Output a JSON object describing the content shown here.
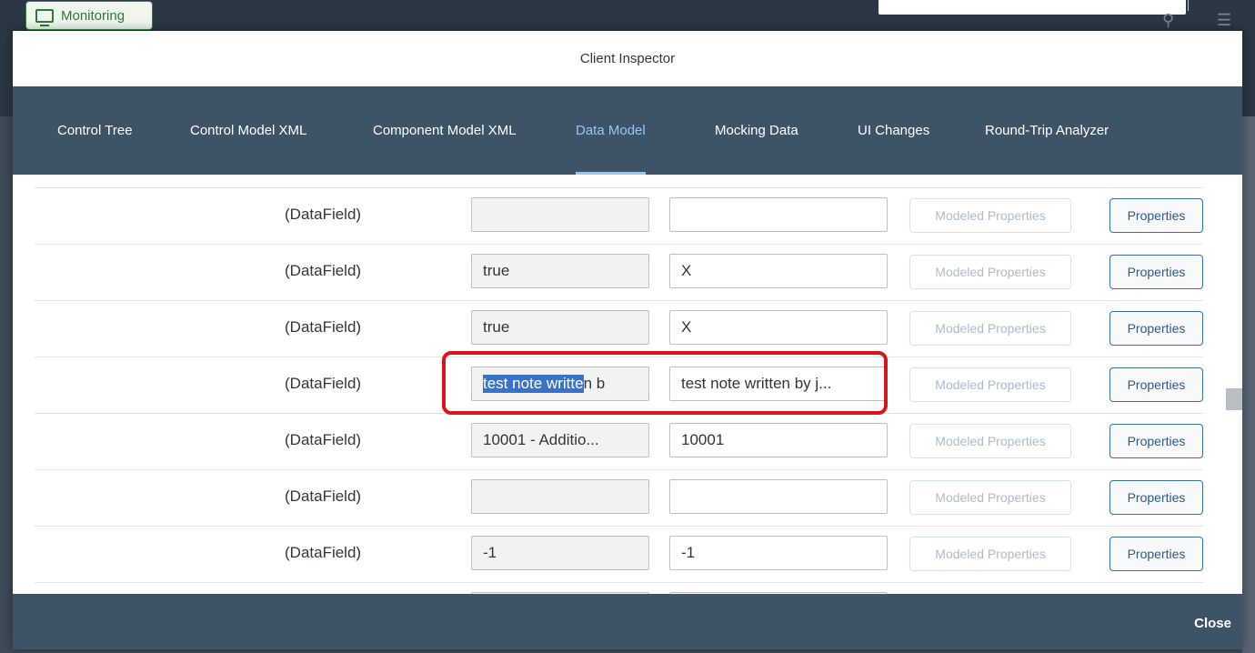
{
  "background": {
    "monitoring_label": "Monitoring"
  },
  "dialog": {
    "title": "Client Inspector",
    "close_label": "Close"
  },
  "tabs": [
    {
      "label": "Control Tree",
      "active": false
    },
    {
      "label": "Control Model XML",
      "active": false
    },
    {
      "label": "Component Model XML",
      "active": false
    },
    {
      "label": "Data Model",
      "active": true
    },
    {
      "label": "Mocking Data",
      "active": false
    },
    {
      "label": "UI Changes",
      "active": false
    },
    {
      "label": "Round-Trip Analyzer",
      "active": false
    }
  ],
  "rows": [
    {
      "label": "(DataField)",
      "value": "",
      "edit": "",
      "modeled_label": "Modeled Properties",
      "properties_label": "Properties"
    },
    {
      "label": "(DataField)",
      "value": "true",
      "edit": "X",
      "modeled_label": "Modeled Properties",
      "properties_label": "Properties"
    },
    {
      "label": "(DataField)",
      "value": "true",
      "edit": "X",
      "modeled_label": "Modeled Properties",
      "properties_label": "Properties"
    },
    {
      "label": "(DataField)",
      "value_selected": "test note writte",
      "value_rest": "n b",
      "edit": "test note written by j...",
      "modeled_label": "Modeled Properties",
      "properties_label": "Properties"
    },
    {
      "label": "(DataField)",
      "value": "10001 - Additio...",
      "edit": "10001",
      "modeled_label": "Modeled Properties",
      "properties_label": "Properties"
    },
    {
      "label": "(DataField)",
      "value": "",
      "edit": "",
      "modeled_label": "Modeled Properties",
      "properties_label": "Properties"
    },
    {
      "label": "(DataField)",
      "value": "-1",
      "edit": "-1",
      "modeled_label": "Modeled Properties",
      "properties_label": "Properties"
    }
  ],
  "colors": {
    "accent": "#91c8f6",
    "header_bar": "#3e5366",
    "highlight": "#d5161e",
    "selection": "#3873c8"
  }
}
